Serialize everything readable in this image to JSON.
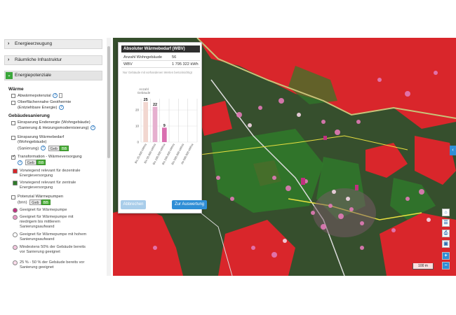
{
  "sidebar": {
    "panels": [
      {
        "label": "Energieerzeugung"
      },
      {
        "label": "Räumliche Infrastruktur"
      },
      {
        "label": "Energiepotenziale"
      }
    ],
    "section_heat": "Wärme",
    "waste_heat": "Abwärmepotenzial",
    "geothermal_line1": "Oberflächennahe Geothermie",
    "geothermal_line2": "(Entziehbare Energie)",
    "section_building": "Gebäudesanierung",
    "final_energy_line1": "Einsparung Endenergie (Wohngebäude)",
    "final_energy_line2": "(Sanierung & Heizungsmodernisierung)",
    "heat_demand_line1": "Einsparung Wärmebedarf",
    "heat_demand_line2": "(Wohngebäude)",
    "heat_demand_line3": "(Sanierung)",
    "transformation": "Transformation - Wärmeversorgung",
    "badge_geb": "Geb",
    "badge_bb": "BB",
    "legend_red_1": "Vorwiegend relevant für dezentrale",
    "legend_red_2": "Energieversorgung",
    "legend_green_1": "Vorwiegend relevant für zentrale",
    "legend_green_2": "Energieversorgung",
    "heatpump_line1": "Potenzial Wärmepumpen",
    "heatpump_line2": "(bnn)",
    "wp_1": "Geeignet für Wärmepumpe",
    "wp_2a": "Geeignet für Wärmepumpe mit",
    "wp_2b": "niedrigem bis mittlerem",
    "wp_2c": "Sanierungsaufwand",
    "wp_3a": "Geeignet für Wärmepumpe mit hohem",
    "wp_3b": "Sanierungsaufwand",
    "wp_4a": "Mindestens 50% der Gebäude bereits",
    "wp_4b": "vor Sanierung geeignet",
    "wp_5a": "25 % - 50 % der Gebäude bereits vor",
    "wp_5b": "Sanierung geeignet"
  },
  "popup": {
    "title": "Absoluter Wärmebedarf (WBV)",
    "rows": [
      {
        "key": "Anzahl Wohngebäude",
        "value": "56"
      },
      {
        "key": "WBV",
        "value": "1 795 322 kWh"
      }
    ],
    "note": "Nur Gebäude mit vorhandenen Werten berücksichtigt",
    "btn_reset": "Abbrechen",
    "btn_eval": "Zur Auswertung"
  },
  "map": {
    "scale_label": "100 m",
    "zoom_in": "+",
    "zoom_out": "−"
  },
  "colors": {
    "red_zone": "#d9262b",
    "green_zone": "#2f7a2a",
    "accent": "#2f8ed6",
    "pink": "#e27ab7"
  },
  "chart_data": {
    "type": "bar",
    "ylabel": "Anzahl Gebäude",
    "ylim": [
      0,
      27
    ],
    "yticks": [
      0,
      10,
      20
    ],
    "categories": [
      "Bis 25.000 kWh/a",
      "Bis 50.000 kWh/a",
      "Bis 100.000 kWh/a",
      "Bis 200.000 kWh/a",
      "Bis 500.000 kWh/a",
      "Ab 500.000 kWh/a"
    ],
    "values": [
      25,
      22,
      9,
      0,
      0,
      0
    ],
    "colors": [
      "#f2d7d0",
      "#e6b0cf",
      "#d96fb0",
      "#e5e5e5",
      "#e5e5e5",
      "#e5e5e5"
    ]
  }
}
